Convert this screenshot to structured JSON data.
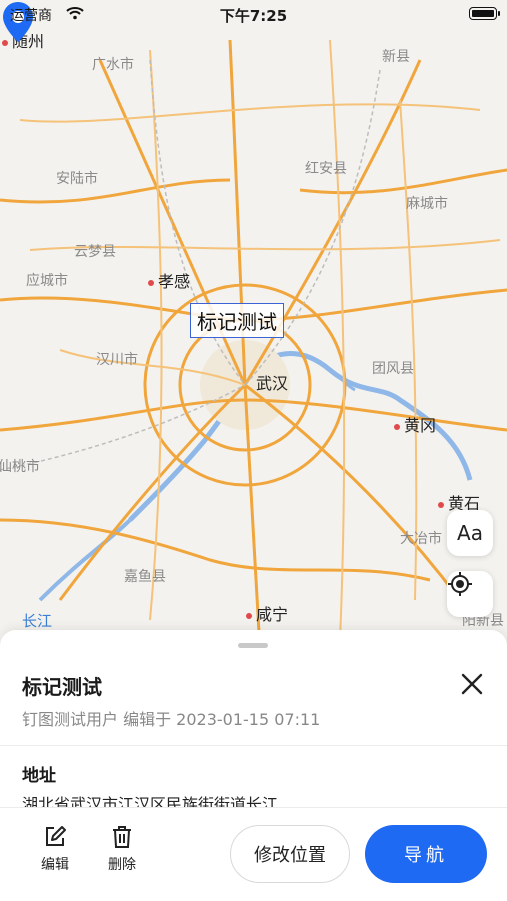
{
  "status_bar": {
    "carrier": "运营商",
    "time": "下午7:25"
  },
  "map": {
    "cities": {
      "suizhou": "随州",
      "guangshui": "广水市",
      "xinxian": "新县",
      "anlu": "安陆市",
      "hongan": "红安县",
      "macheng": "麻城市",
      "yunmeng": "云梦县",
      "yingcheng": "应城市",
      "xiaogan": "孝感",
      "hanchuan": "汉川市",
      "wuhan": "武汉",
      "tuanfeng": "团风县",
      "huanggang": "黄冈",
      "xiantao": "仙桃市",
      "huangshi": "黄石",
      "daye": "大冶市",
      "jiayu": "嘉鱼县",
      "xianning": "咸宁",
      "yangxin": "阳新县"
    },
    "river_label": "长江",
    "marker_label": "标记测试"
  },
  "map_buttons": {
    "text_size": "Aa"
  },
  "sheet": {
    "title": "标记测试",
    "meta": "钉图测试用户 编辑于 2023-01-15 07:11",
    "address_label": "地址",
    "address": "湖北省武汉市江汉区民族街街道长江"
  },
  "toolbar": {
    "edit": "编辑",
    "delete": "删除",
    "modify_location": "修改位置",
    "navigate": "导航"
  },
  "colors": {
    "accent": "#1e6af2",
    "road": "#f0a63c",
    "river": "#8fb8e8"
  }
}
